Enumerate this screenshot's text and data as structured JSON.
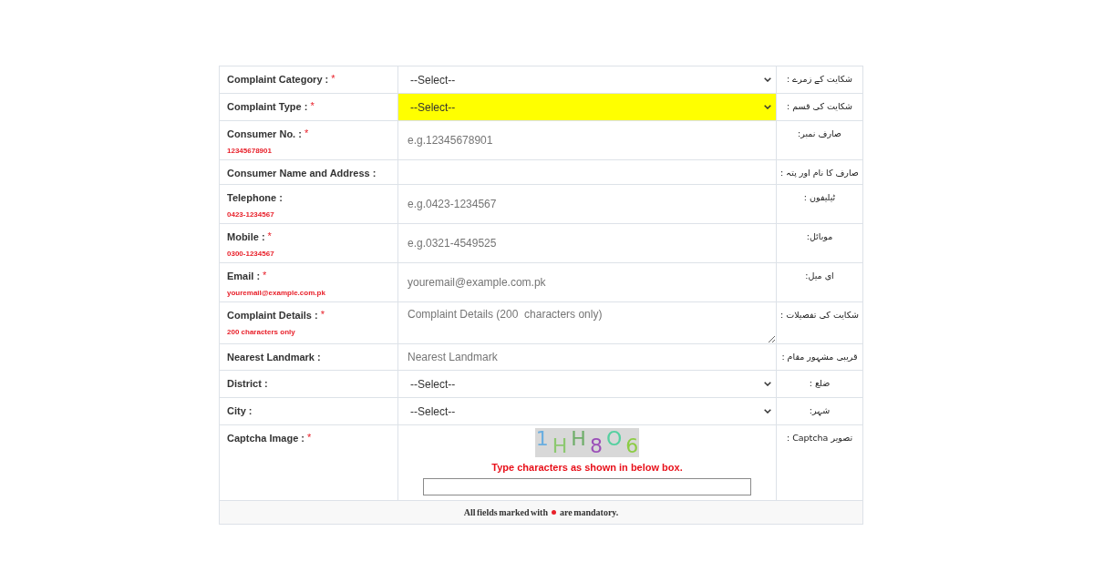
{
  "form": {
    "rows": [
      {
        "label": "Complaint Category :",
        "required_mark": "*",
        "field": {
          "kind": "select",
          "value": "--Select--",
          "highlighted": false
        },
        "urdu_label": "شکایت کے زمرے :"
      },
      {
        "label": "Complaint Type :",
        "required_mark": "*",
        "field": {
          "kind": "select",
          "value": "--Select--",
          "highlighted": true
        },
        "urdu_label": "شکایت کی قسم :"
      },
      {
        "label": "Consumer No. :",
        "required_mark": "*",
        "hint": "12345678901",
        "field": {
          "kind": "input",
          "placeholder": "e.g.12345678901"
        },
        "urdu_label": "صارف نمبر:"
      },
      {
        "label": "Consumer Name and Address :",
        "urdu_label": "صارف کا نام اور پتہ :"
      },
      {
        "label": "Telephone :",
        "hint": "0423-1234567",
        "field": {
          "kind": "input",
          "placeholder": "e.g.0423-1234567"
        },
        "urdu_label": "ٹیلیفون :"
      },
      {
        "label": "Mobile :",
        "required_mark": "*",
        "hint": "0300-1234567",
        "field": {
          "kind": "input",
          "placeholder": "e.g.0321-4549525"
        },
        "urdu_label": "موبائل:"
      },
      {
        "label": "Email :",
        "required_mark": "*",
        "hint": "youremail@example.com.pk",
        "field": {
          "kind": "input",
          "placeholder": "youremail@example.com.pk"
        },
        "urdu_label": "ای میل:"
      },
      {
        "label": "Complaint Details :",
        "required_mark": "*",
        "hint": "200 characters only",
        "field": {
          "kind": "textarea",
          "placeholder": "Complaint Details (200  characters only)"
        },
        "urdu_label": "شکایت کی تفصیلات :"
      },
      {
        "label": "Nearest Landmark :",
        "field": {
          "kind": "input",
          "placeholder": "Nearest Landmark"
        },
        "urdu_label": "قریبی مشہور مقام :"
      },
      {
        "label": "District :",
        "field": {
          "kind": "select",
          "value": "--Select--",
          "highlighted": false
        },
        "urdu_label": "ضلع :"
      },
      {
        "label": "City :",
        "field": {
          "kind": "select",
          "value": "--Select--",
          "highlighted": false
        },
        "urdu_label": "شہر:"
      },
      {
        "label": "Captcha Image :",
        "required_mark": "*",
        "field": {
          "kind": "captcha",
          "characters": [
            {
              "char": "1",
              "color": "#6aaee0"
            },
            {
              "char": "H",
              "color": "#8cc870"
            },
            {
              "char": "H",
              "color": "#6fae6a"
            },
            {
              "char": "8",
              "color": "#9b4fb8"
            },
            {
              "char": "O",
              "color": "#55d0a0"
            },
            {
              "char": "6",
              "color": "#8ccc44"
            }
          ],
          "instruction": "Type characters as shown in below box."
        },
        "urdu_label": "تصویر Captcha :"
      }
    ],
    "footer": {
      "text_before": "All fields marked with",
      "text_after": "are mandatory."
    }
  }
}
